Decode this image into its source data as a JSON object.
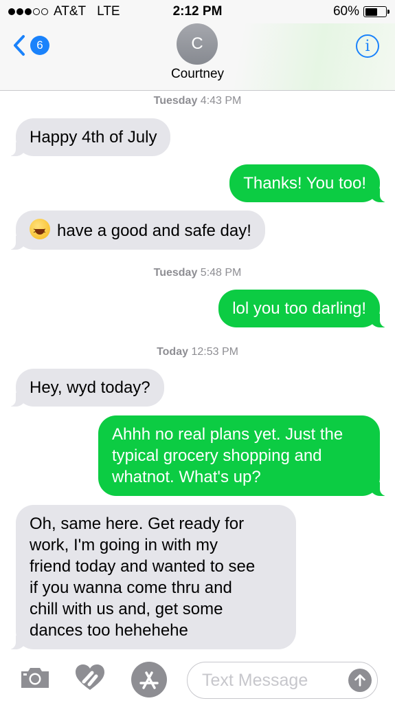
{
  "status_bar": {
    "carrier": "AT&T",
    "network": "LTE",
    "time": "2:12 PM",
    "battery_percent": "60%",
    "battery_level": 0.6,
    "signal_bars_filled": 3,
    "signal_bars_total": 5
  },
  "header": {
    "back_badge": "6",
    "avatar_initial": "C",
    "contact_name": "Courtney",
    "info_label": "i",
    "accent_color": "#1a82fb"
  },
  "conversation": {
    "timestamp_1": {
      "day": "Tuesday",
      "time": "4:43 PM"
    },
    "msg_1": "Happy 4th of July",
    "msg_2": "Thanks! You too!",
    "msg_3_emoji": "laughing-emoji",
    "msg_3": "have a good and safe day!",
    "timestamp_2": {
      "day": "Tuesday",
      "time": "5:48 PM"
    },
    "msg_4": "lol you too darling!",
    "timestamp_3": {
      "day": "Today",
      "time": "12:53 PM"
    },
    "msg_5": "Hey, wyd today?",
    "msg_6_lines": [
      "Ahhh no real plans yet. Just the",
      "typical grocery shopping and",
      "whatnot. What's up?"
    ],
    "msg_7_lines": [
      "Oh, same here. Get ready for",
      "work, I'm going in with my",
      "friend today and wanted to see",
      "if you wanna come thru and",
      "chill with us and, get some",
      "dances too hehehehe"
    ],
    "incoming_color": "#e5e5ea",
    "outgoing_color": "#0ccc43"
  },
  "input_bar": {
    "placeholder": "Text Message",
    "icons": [
      "camera-icon",
      "digital-touch-icon",
      "app-store-icon",
      "send-arrow-icon"
    ]
  }
}
